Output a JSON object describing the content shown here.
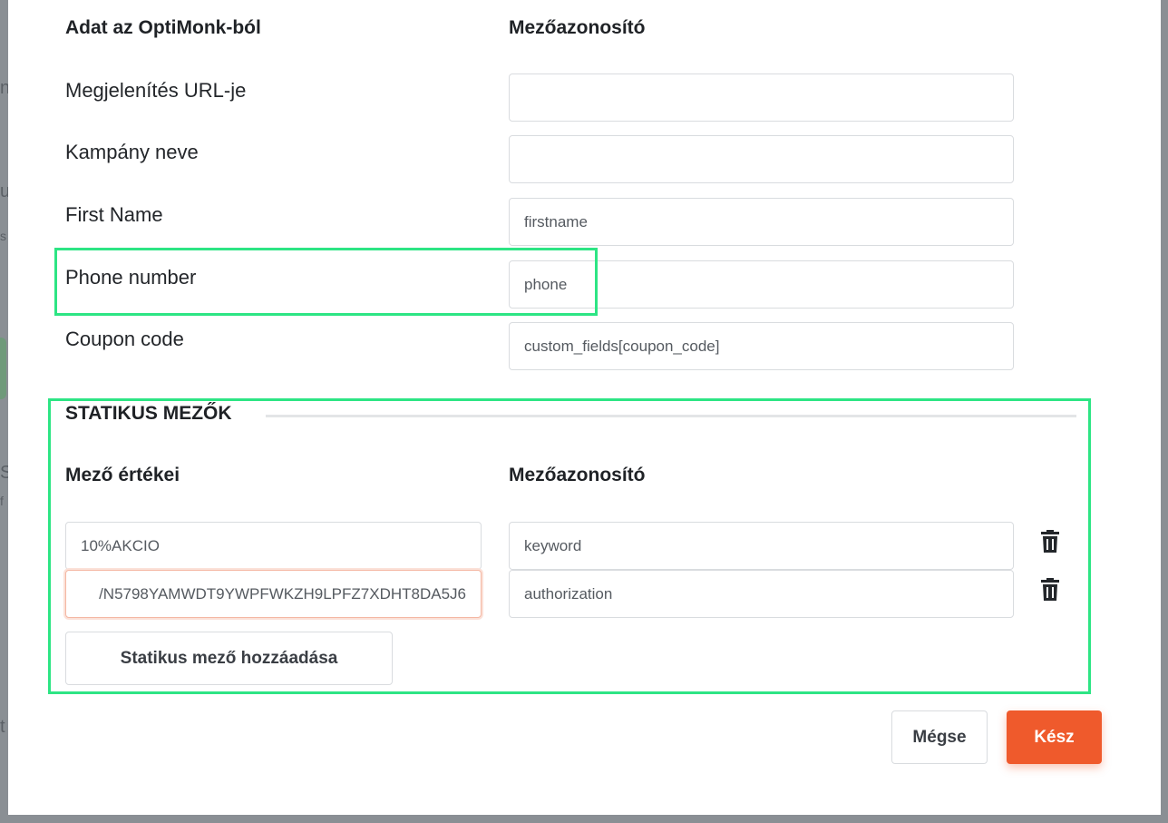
{
  "backdrop": {
    "fragments": [
      "n",
      "u",
      "s",
      "S",
      "f",
      "t"
    ]
  },
  "mapping": {
    "header_data": "Adat az OptiMonk-ból",
    "header_field_id": "Mezőazonosító",
    "rows": [
      {
        "label": "Megjelenítés URL-je",
        "value": ""
      },
      {
        "label": "Kampány neve",
        "value": ""
      },
      {
        "label": "First Name",
        "value": "firstname"
      },
      {
        "label": "Phone number",
        "value": "phone"
      },
      {
        "label": "Coupon code",
        "value": "custom_fields[coupon_code]"
      }
    ]
  },
  "static_fields": {
    "title": "STATIKUS MEZŐK",
    "header_values": "Mező értékei",
    "header_field_id": "Mezőazonosító",
    "rows": [
      {
        "value": "10%AKCIO",
        "field_id": "keyword",
        "delete_icon": "trash-icon"
      },
      {
        "value": "/N5798YAMWDT9YWPFWKZH9LPFZ7XDHT8DA5J6",
        "field_id": "authorization",
        "delete_icon": "trash-icon"
      }
    ],
    "add_button": "Statikus mező hozzáadása"
  },
  "footer": {
    "cancel": "Mégse",
    "done": "Kész"
  },
  "colors": {
    "accent": "#ef5a2c",
    "highlight": "#2de584"
  }
}
